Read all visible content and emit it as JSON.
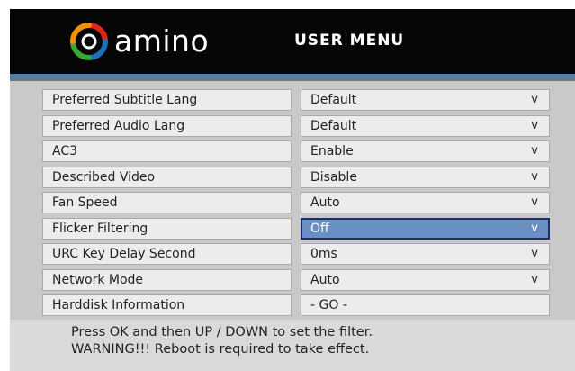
{
  "header": {
    "logo_text": "amino",
    "title": "USER MENU"
  },
  "menu": {
    "rows": [
      {
        "label": "Preferred Subtitle Lang",
        "value": "Default",
        "arrow": "v"
      },
      {
        "label": "Preferred Audio Lang",
        "value": "Default",
        "arrow": "v"
      },
      {
        "label": "AC3",
        "value": "Enable",
        "arrow": "v"
      },
      {
        "label": "Described Video",
        "value": "Disable",
        "arrow": "v"
      },
      {
        "label": "Fan Speed",
        "value": "Auto",
        "arrow": "v"
      },
      {
        "label": "Flicker Filtering",
        "value": "Off",
        "arrow": "v"
      },
      {
        "label": "URC Key Delay Second",
        "value": "0ms",
        "arrow": "v"
      },
      {
        "label": "Network Mode",
        "value": "Auto",
        "arrow": "v"
      },
      {
        "label": "Harddisk Information",
        "value": "- GO -",
        "arrow": ""
      }
    ]
  },
  "footer": {
    "line1": "Press OK and then UP / DOWN to set the filter.",
    "line2": "WARNING!!! Reboot is required to take effect."
  },
  "colors": {
    "header_bg": "#060606",
    "accent_stripe": "#4d7fae",
    "panel_bg": "#c9c9c9",
    "selected_bg": "#6a8fc2",
    "selected_border": "#1d2f66",
    "logo_red": "#e1251b",
    "logo_orange": "#f39200",
    "logo_green": "#39a935",
    "logo_blue": "#1d71b8"
  }
}
